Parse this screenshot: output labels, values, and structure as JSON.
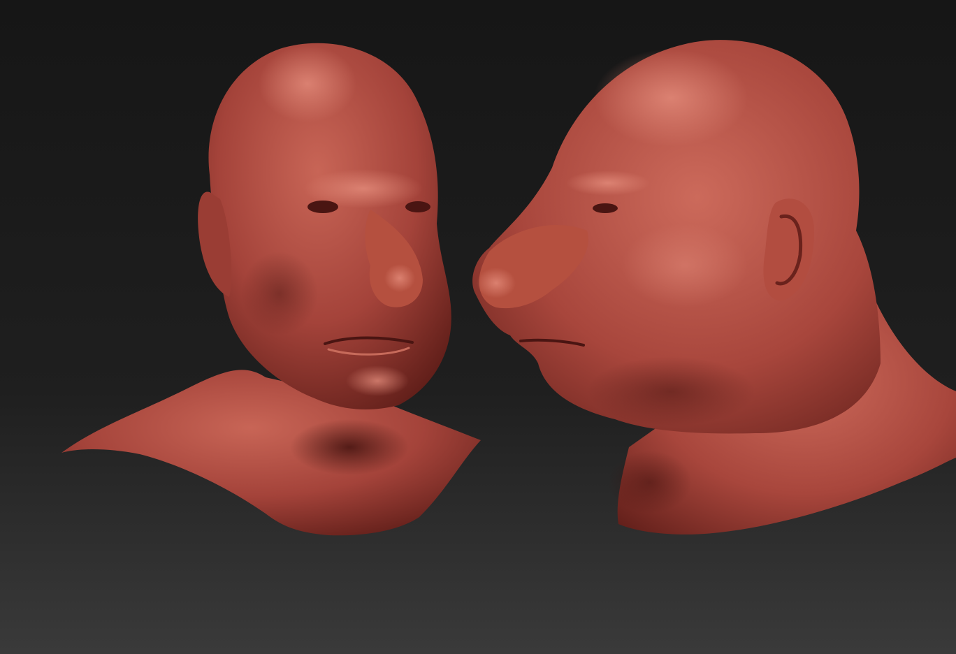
{
  "scene": {
    "background_top": "#141414",
    "background_bottom": "#3a3a3a",
    "clay_base": "#a8443a",
    "clay_light": "#cf6c5e",
    "clay_shadow": "#5a1c17"
  },
  "views": [
    {
      "name": "front-three-quarter"
    },
    {
      "name": "side-profile"
    }
  ]
}
